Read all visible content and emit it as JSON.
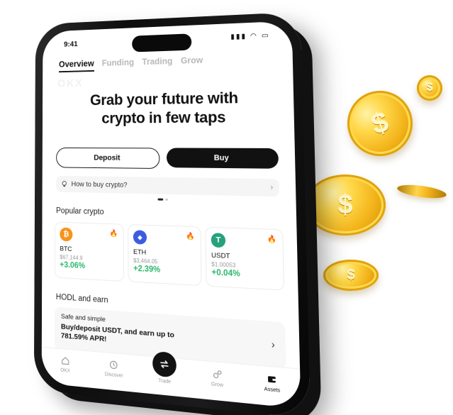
{
  "status_bar": {
    "time": "9:41"
  },
  "tabs": [
    {
      "label": "Overview",
      "active": true
    },
    {
      "label": "Funding",
      "active": false
    },
    {
      "label": "Trading",
      "active": false
    },
    {
      "label": "Grow",
      "active": false
    }
  ],
  "watermark": "OKX",
  "hero": {
    "line1": "Grab your future with",
    "line2": "crypto in few taps"
  },
  "actions": {
    "deposit_label": "Deposit",
    "buy_label": "Buy"
  },
  "howto": {
    "label": "How to buy crypto?"
  },
  "popular": {
    "title": "Popular crypto",
    "items": [
      {
        "symbol": "BTC",
        "price": "$67,144.9",
        "change": "+3.06%",
        "color": "#f7931a",
        "icon": "bitcoin-icon",
        "glyph": "₿"
      },
      {
        "symbol": "ETH",
        "price": "$3,464.05",
        "change": "+2.39%",
        "color": "#3c5ce0",
        "icon": "ethereum-icon",
        "glyph": "◆"
      },
      {
        "symbol": "USDT",
        "price": "$1.00053",
        "change": "+0.04%",
        "color": "#26a17b",
        "icon": "tether-icon",
        "glyph": "T"
      }
    ]
  },
  "earn": {
    "title": "HODL and earn",
    "small": "Safe and simple",
    "big": "Buy/deposit USDT, and earn up to 781.59% APR!"
  },
  "nav": [
    {
      "label": "OKX",
      "icon": "home-icon",
      "active": false
    },
    {
      "label": "Discover",
      "icon": "discover-icon",
      "active": false
    },
    {
      "label": "Trade",
      "icon": "trade-icon",
      "active": false
    },
    {
      "label": "Grow",
      "icon": "grow-icon",
      "active": false
    },
    {
      "label": "Assets",
      "icon": "wallet-icon",
      "active": true
    }
  ],
  "coin_symbol": "$",
  "colors": {
    "up": "#29b86a",
    "accent": "#111111",
    "coin": "#f3b31a"
  }
}
